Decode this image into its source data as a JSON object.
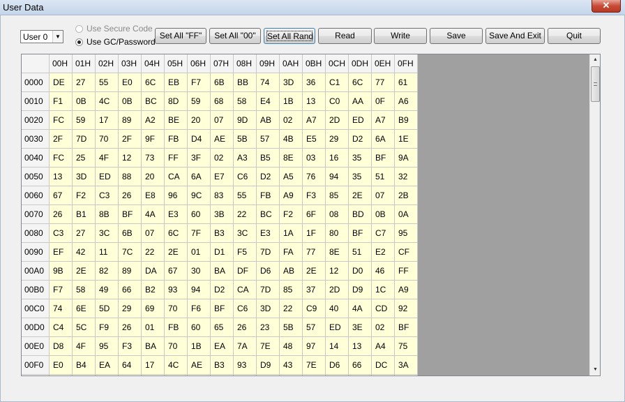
{
  "window": {
    "title": "User Data",
    "close_glyph": "✕"
  },
  "toolbar": {
    "user_select": {
      "value": "User 0",
      "arrow": "▼"
    },
    "radio_secure": "Use Secure Code",
    "radio_gc": "Use GC/Password",
    "buttons": {
      "set_all_ff": "Set All \"FF\"",
      "set_all_00": "Set All \"00\"",
      "set_all_rand": "Set All Rand",
      "read": "Read",
      "write": "Write",
      "save": "Save",
      "save_exit": "Save And Exit",
      "quit": "Quit"
    }
  },
  "grid": {
    "columns": [
      "00H",
      "01H",
      "02H",
      "03H",
      "04H",
      "05H",
      "06H",
      "07H",
      "08H",
      "09H",
      "0AH",
      "0BH",
      "0CH",
      "0DH",
      "0EH",
      "0FH"
    ],
    "rows": [
      {
        "addr": "0000",
        "cells": [
          "DE",
          "27",
          "55",
          "E0",
          "6C",
          "EB",
          "F7",
          "6B",
          "BB",
          "74",
          "3D",
          "36",
          "C1",
          "6C",
          "77",
          "61"
        ]
      },
      {
        "addr": "0010",
        "cells": [
          "F1",
          "0B",
          "4C",
          "0B",
          "BC",
          "8D",
          "59",
          "68",
          "58",
          "E4",
          "1B",
          "13",
          "C0",
          "AA",
          "0F",
          "A6"
        ]
      },
      {
        "addr": "0020",
        "cells": [
          "FC",
          "59",
          "17",
          "89",
          "A2",
          "BE",
          "20",
          "07",
          "9D",
          "AB",
          "02",
          "A7",
          "2D",
          "ED",
          "A7",
          "B9"
        ]
      },
      {
        "addr": "0030",
        "cells": [
          "2F",
          "7D",
          "70",
          "2F",
          "9F",
          "FB",
          "D4",
          "AE",
          "5B",
          "57",
          "4B",
          "E5",
          "29",
          "D2",
          "6A",
          "1E"
        ]
      },
      {
        "addr": "0040",
        "cells": [
          "FC",
          "25",
          "4F",
          "12",
          "73",
          "FF",
          "3F",
          "02",
          "A3",
          "B5",
          "8E",
          "03",
          "16",
          "35",
          "BF",
          "9A"
        ]
      },
      {
        "addr": "0050",
        "cells": [
          "13",
          "3D",
          "ED",
          "88",
          "20",
          "CA",
          "6A",
          "E7",
          "C6",
          "D2",
          "A5",
          "76",
          "94",
          "35",
          "51",
          "32"
        ]
      },
      {
        "addr": "0060",
        "cells": [
          "67",
          "F2",
          "C3",
          "26",
          "E8",
          "96",
          "9C",
          "83",
          "55",
          "FB",
          "A9",
          "F3",
          "85",
          "2E",
          "07",
          "2B"
        ]
      },
      {
        "addr": "0070",
        "cells": [
          "26",
          "B1",
          "8B",
          "BF",
          "4A",
          "E3",
          "60",
          "3B",
          "22",
          "BC",
          "F2",
          "6F",
          "08",
          "BD",
          "0B",
          "0A"
        ]
      },
      {
        "addr": "0080",
        "cells": [
          "C3",
          "27",
          "3C",
          "6B",
          "07",
          "6C",
          "7F",
          "B3",
          "3C",
          "E3",
          "1A",
          "1F",
          "80",
          "BF",
          "C7",
          "95"
        ]
      },
      {
        "addr": "0090",
        "cells": [
          "EF",
          "42",
          "11",
          "7C",
          "22",
          "2E",
          "01",
          "D1",
          "F5",
          "7D",
          "FA",
          "77",
          "8E",
          "51",
          "E2",
          "CF"
        ]
      },
      {
        "addr": "00A0",
        "cells": [
          "9B",
          "2E",
          "82",
          "89",
          "DA",
          "67",
          "30",
          "BA",
          "DF",
          "D6",
          "AB",
          "2E",
          "12",
          "D0",
          "46",
          "FF"
        ]
      },
      {
        "addr": "00B0",
        "cells": [
          "F7",
          "58",
          "49",
          "66",
          "B2",
          "93",
          "94",
          "D2",
          "CA",
          "7D",
          "85",
          "37",
          "2D",
          "D9",
          "1C",
          "A9"
        ]
      },
      {
        "addr": "00C0",
        "cells": [
          "74",
          "6E",
          "5D",
          "29",
          "69",
          "70",
          "F6",
          "BF",
          "C6",
          "3D",
          "22",
          "C9",
          "40",
          "4A",
          "CD",
          "92"
        ]
      },
      {
        "addr": "00D0",
        "cells": [
          "C4",
          "5C",
          "F9",
          "26",
          "01",
          "FB",
          "60",
          "65",
          "26",
          "23",
          "5B",
          "57",
          "ED",
          "3E",
          "02",
          "BF"
        ]
      },
      {
        "addr": "00E0",
        "cells": [
          "D8",
          "4F",
          "95",
          "F3",
          "BA",
          "70",
          "1B",
          "EA",
          "7A",
          "7E",
          "48",
          "97",
          "14",
          "13",
          "A4",
          "75"
        ]
      },
      {
        "addr": "00F0",
        "cells": [
          "E0",
          "B4",
          "EA",
          "64",
          "17",
          "4C",
          "AE",
          "B3",
          "93",
          "D9",
          "43",
          "7E",
          "D6",
          "66",
          "DC",
          "3A"
        ]
      },
      {
        "addr": "",
        "cells": [
          "",
          "",
          "",
          "",
          "",
          "",
          "",
          "",
          "",
          "",
          "",
          "",
          "",
          "",
          "",
          ""
        ]
      }
    ]
  },
  "scrollbar": {
    "up_glyph": "▲",
    "down_glyph": "▼"
  },
  "colors": {
    "data_cell": "#ffffd8",
    "header": "#f4f4f4",
    "empty_area": "#a0a0a0"
  }
}
